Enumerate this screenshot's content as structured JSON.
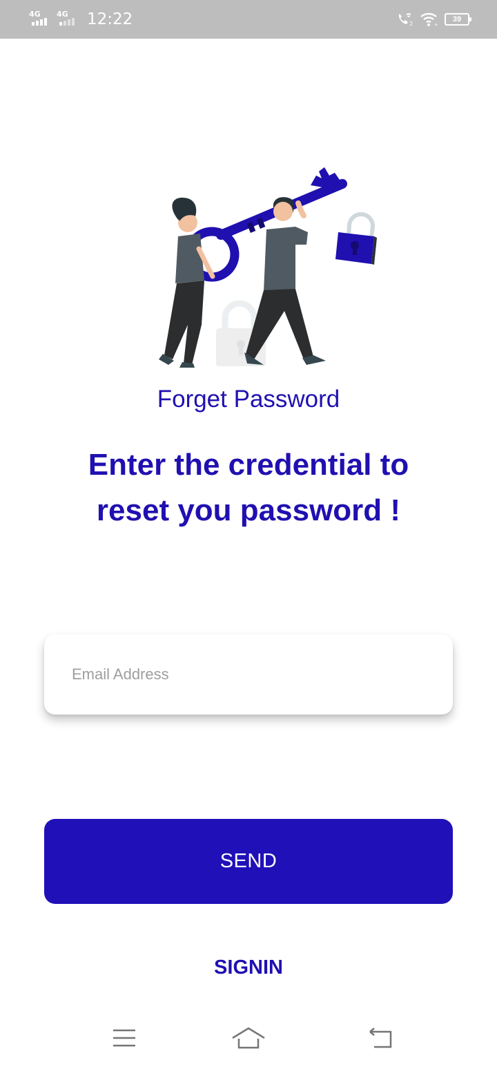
{
  "status_bar": {
    "network_1": "4G",
    "network_2": "4G",
    "time": "12:22",
    "battery_level": "39",
    "icons": [
      "signal-icon",
      "signal-weak-icon",
      "wifi-calling-icon",
      "wifi-icon",
      "battery-icon"
    ]
  },
  "illustration": {
    "name": "people-carrying-key-illustration",
    "colors": {
      "primary": "#2010b0",
      "clothing": "#4f5a62",
      "pants": "#2b2d2e",
      "skin": "#f2c1a0",
      "hair": "#263238",
      "lock_faded": "#eeeeee"
    }
  },
  "page": {
    "title": "Forget Password",
    "subtitle": "Enter the credential to reset you password !"
  },
  "form": {
    "email_placeholder": "Email Address",
    "email_value": ""
  },
  "actions": {
    "send_label": "SEND",
    "signin_label": "SIGNIN"
  },
  "nav_bar": {
    "icons": [
      "menu-icon",
      "home-icon",
      "back-icon"
    ]
  },
  "colors": {
    "accent": "#2010b8",
    "status_bar": "#bdbdbd",
    "placeholder": "#9e9e9e",
    "background": "#ffffff"
  }
}
